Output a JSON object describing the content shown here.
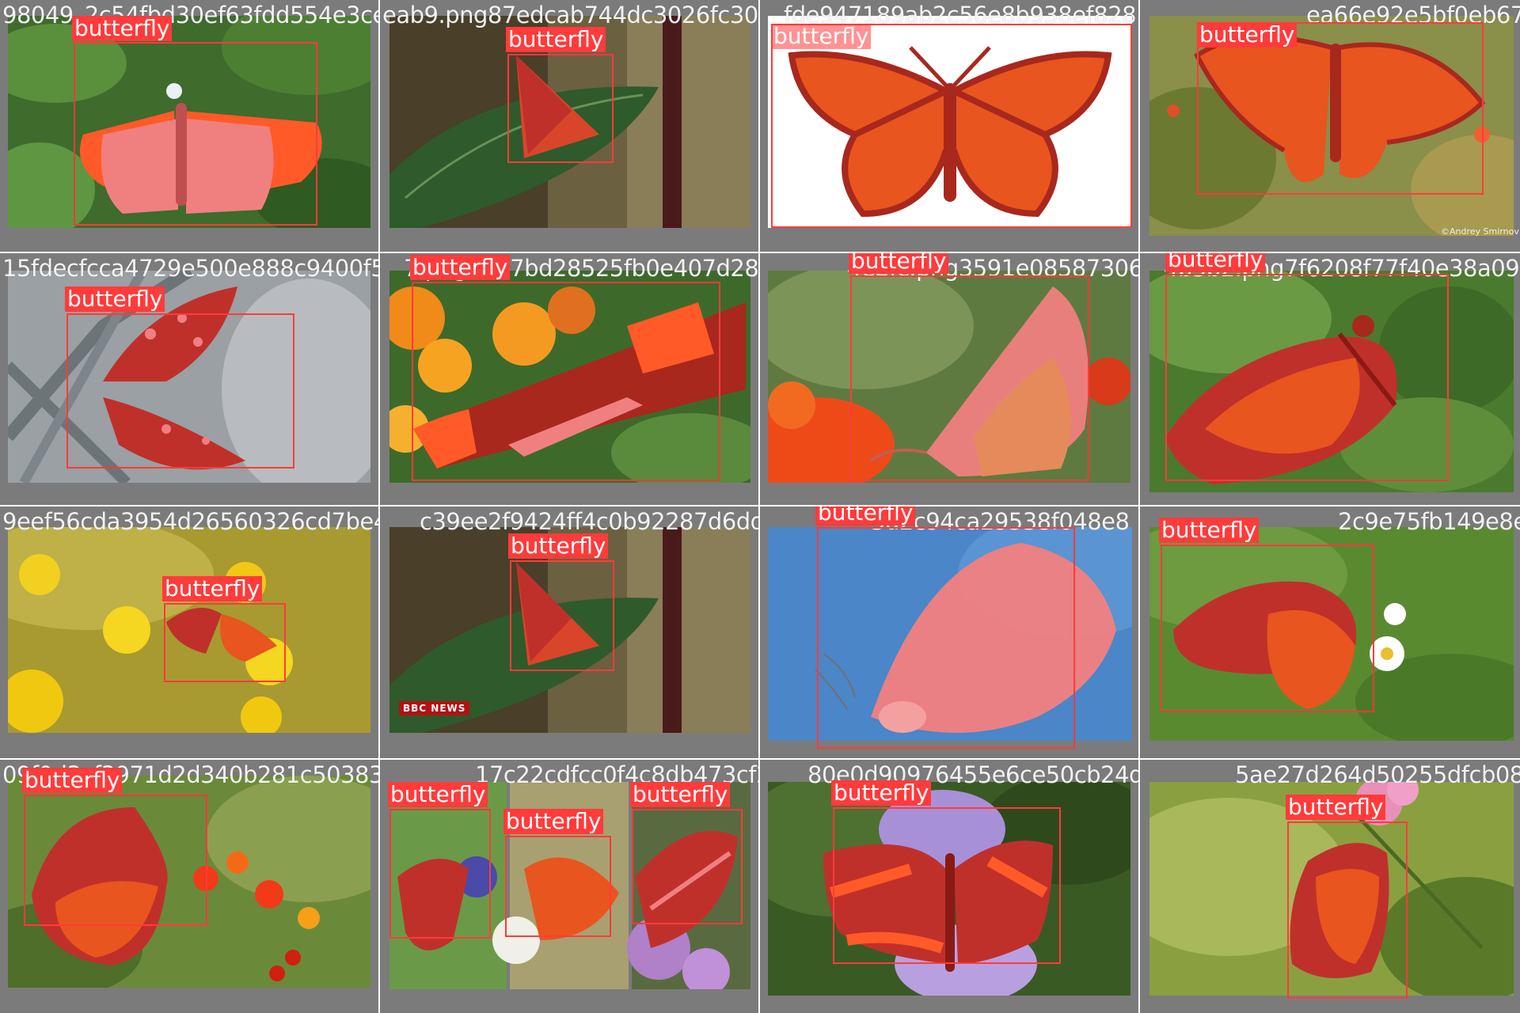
{
  "detection_label": "butterfly",
  "colors": {
    "box": "#ff3b3b",
    "mask_light": "#f08080",
    "mask_dark": "#c0302a",
    "mask_orange": "#e8551e",
    "cell_bg": "#7b7b7b"
  },
  "cells": [
    {
      "filename": "98049_2c54fbd30ef63fdd554e3cea5b0.png",
      "scene": "green-leaves-white-butterfly",
      "overlays": [
        "butterfly"
      ]
    },
    {
      "filename": "eab9.png87edcab744dc3026fc3088f7f1064",
      "scene": "dark-leaf-stem",
      "overlays": [
        "butterfly"
      ]
    },
    {
      "filename": "fde947189ab2c56e8b938ef82813a4377ea66e92e5bf0eb67",
      "scene": "white-background-monarch",
      "overlays": [
        "butterfly"
      ]
    },
    {
      "filename": "ea66e92e5bf0eb67",
      "scene": "garden-monarch",
      "overlays": [
        "butterfly"
      ],
      "watermark": "©Andrey Smirnov"
    },
    {
      "filename": "15fdecfcca4729e500e888c9400f53",
      "scene": "chain-link-fence",
      "overlays": [
        "butterfly"
      ]
    },
    {
      "filename": "7.png4687bd28525fb0e407d281c9",
      "scene": "lantana-flowers-red-black",
      "overlays": [
        "butterfly"
      ]
    },
    {
      "filename": "4e2fc.png3591e0858730650",
      "scene": "orange-flowers-orange-butterfly",
      "overlays": [
        "butterfly"
      ]
    },
    {
      "filename": "4b5b2.png7f6208f77f40e38a090",
      "scene": "green-bush-monarch",
      "overlays": [
        "butterfly"
      ]
    },
    {
      "filename": "9eef56cda3954d26560326cd7be423304.png",
      "scene": "yellow-flowers-monarch",
      "overlays": [
        "butterfly"
      ]
    },
    {
      "filename": "c39ee2f9424ff4c0b92287d6dd.png",
      "scene": "dark-leaf-stem-bbc",
      "overlays": [
        "butterfly"
      ],
      "badge": "BBC NEWS"
    },
    {
      "filename": "5d2c94ca29538f048e8",
      "scene": "blue-sky-pale-butterfly",
      "overlays": [
        "butterfly"
      ]
    },
    {
      "filename": "2c9e75fb149e8e1c8f70",
      "scene": "green-field-monarch",
      "overlays": [
        "butterfly"
      ]
    },
    {
      "filename": "09f0d3cf3971d2d340b281c503838d9a4",
      "scene": "milkweed-monarch",
      "overlays": [
        "butterfly"
      ]
    },
    {
      "filename": "17c22cdfcc0f4c8db473cf24",
      "scene": "triptych",
      "overlays": [
        "butterfly",
        "butterfly",
        "butterfly"
      ]
    },
    {
      "filename": "80e0d90976455e6ce50cb24d2",
      "scene": "purple-buddleia-admiral",
      "overlays": [
        "butterfly"
      ]
    },
    {
      "filename": "5ae27d264d50255dfcb08f9ea70",
      "scene": "pink-flower-monarch",
      "overlays": [
        "butterfly"
      ]
    }
  ]
}
